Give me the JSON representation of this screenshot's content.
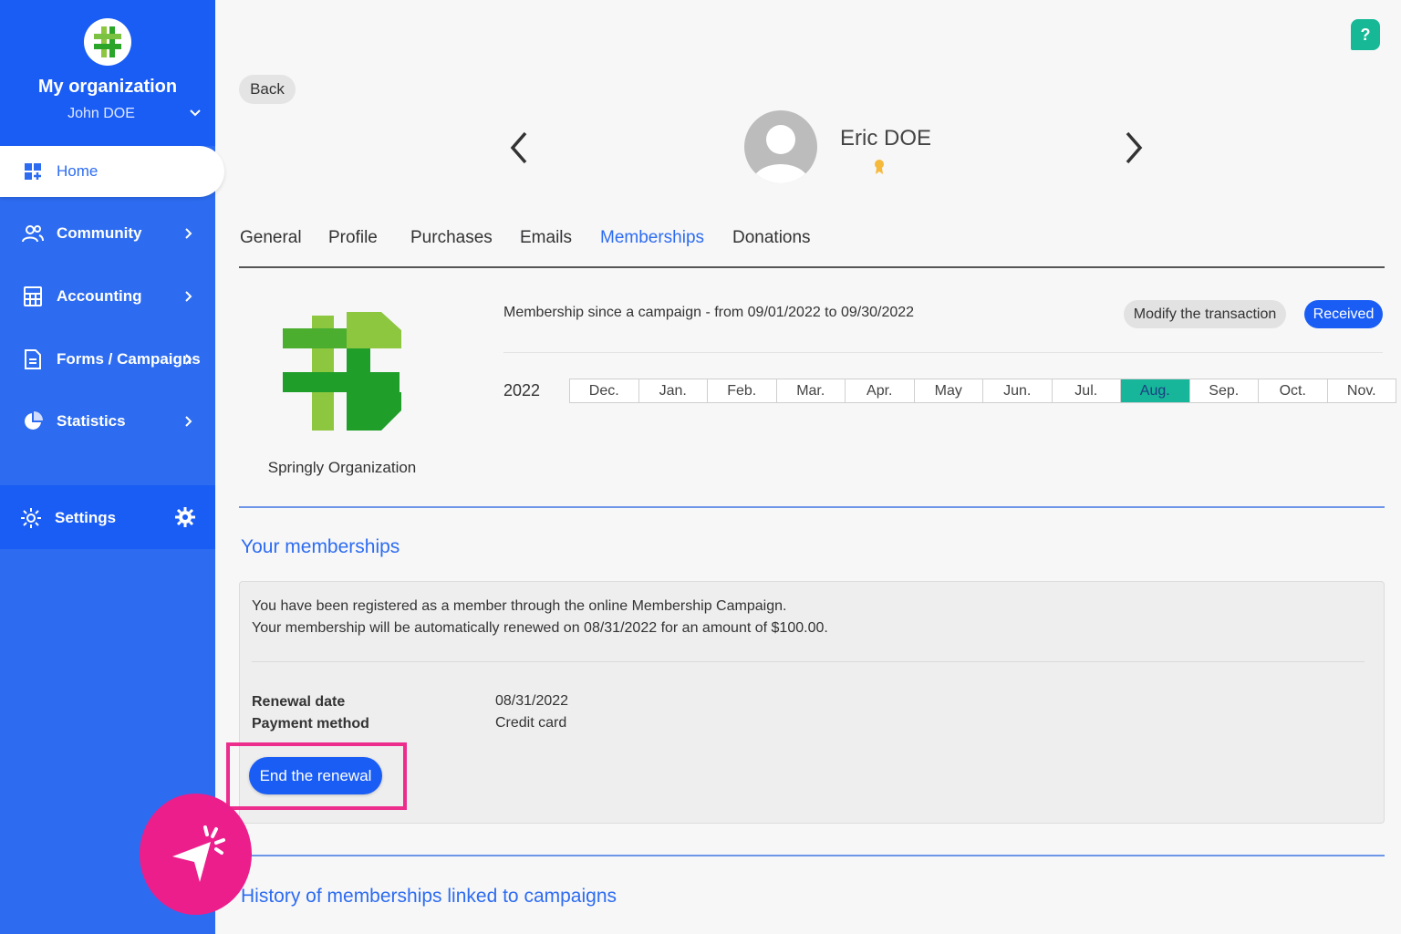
{
  "org": {
    "name": "My organization",
    "user": "John DOE"
  },
  "sidebar": {
    "items": [
      {
        "label": "Home",
        "icon": "grid-icon"
      },
      {
        "label": "Community",
        "icon": "users-icon"
      },
      {
        "label": "Accounting",
        "icon": "calculator-icon"
      },
      {
        "label": "Forms / Campaigns",
        "icon": "document-icon"
      },
      {
        "label": "Statistics",
        "icon": "pie-chart-icon"
      },
      {
        "label": "Settings",
        "icon": "gear-icon"
      }
    ]
  },
  "header": {
    "back_label": "Back",
    "help_label": "?"
  },
  "contact": {
    "name": "Eric DOE"
  },
  "tabs": [
    {
      "label": "General"
    },
    {
      "label": "Profile"
    },
    {
      "label": "Purchases"
    },
    {
      "label": "Emails"
    },
    {
      "label": "Memberships",
      "active": true
    },
    {
      "label": "Donations"
    }
  ],
  "organization_card": {
    "caption": "Springly Organization"
  },
  "membership": {
    "since_text": "Membership since a campaign - from 09/01/2022 to 09/30/2022",
    "modify_label": "Modify the transaction",
    "status": "Received",
    "year": "2022",
    "months": [
      "Dec.",
      "Jan.",
      "Feb.",
      "Mar.",
      "Apr.",
      "May",
      "Jun.",
      "Jul.",
      "Aug.",
      "Sep.",
      "Oct.",
      "Nov."
    ],
    "active_month": "Aug."
  },
  "your_memberships": {
    "title": "Your memberships",
    "line1": "You have been registered as a member through the online Membership Campaign.",
    "line2": "Your membership will be automatically renewed on 08/31/2022 for an amount of $100.00.",
    "renewal_date_label": "Renewal date",
    "renewal_date_value": "08/31/2022",
    "payment_method_label": "Payment method",
    "payment_method_value": "Credit card",
    "end_renewal_label": "End the renewal"
  },
  "history": {
    "title": "History of memberships linked to campaigns"
  },
  "colors": {
    "sidebar": "#2d6cf0",
    "sidebar_dark": "#1a5df5",
    "accent": "#1a5df5",
    "active_month": "#17b59a",
    "highlight": "#ec2d8c",
    "help": "#16b896"
  }
}
